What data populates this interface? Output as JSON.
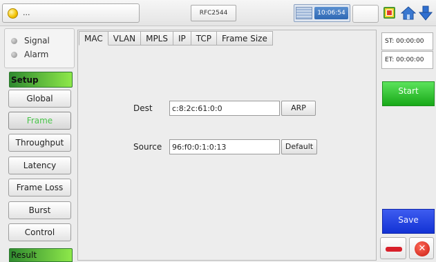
{
  "topbar": {
    "status_text": "...",
    "test_name": "RFC2544",
    "clock": "10:06:54"
  },
  "indicators": [
    {
      "label": "Signal"
    },
    {
      "label": "Alarm"
    }
  ],
  "sidebar": {
    "setup_heading": "Setup",
    "items": [
      {
        "label": "Global"
      },
      {
        "label": "Frame",
        "active": true
      },
      {
        "label": "Throughput"
      },
      {
        "label": "Latency"
      },
      {
        "label": "Frame Loss"
      },
      {
        "label": "Burst"
      },
      {
        "label": "Control"
      }
    ],
    "result_heading": "Result"
  },
  "tabs": [
    {
      "label": "MAC",
      "active": true
    },
    {
      "label": "VLAN"
    },
    {
      "label": "MPLS"
    },
    {
      "label": "IP"
    },
    {
      "label": "TCP"
    },
    {
      "label": "Frame Size"
    }
  ],
  "mac_form": {
    "dest_label": "Dest",
    "dest_value": "c:8:2c:61:0:0",
    "arp_button": "ARP",
    "source_label": "Source",
    "source_value": "96:f0:0:1:0:13",
    "default_button": "Default"
  },
  "right_panel": {
    "start_time": "ST: 00:00:00",
    "end_time": "ET: 00:00:00",
    "start_label": "Start",
    "save_label": "Save",
    "close_glyph": "✕"
  },
  "colors": {
    "accent_green": "#2fae2f",
    "save_blue": "#1a3ae0",
    "active_nav_text": "#49c449",
    "clock_blue": "#2e68b4"
  }
}
